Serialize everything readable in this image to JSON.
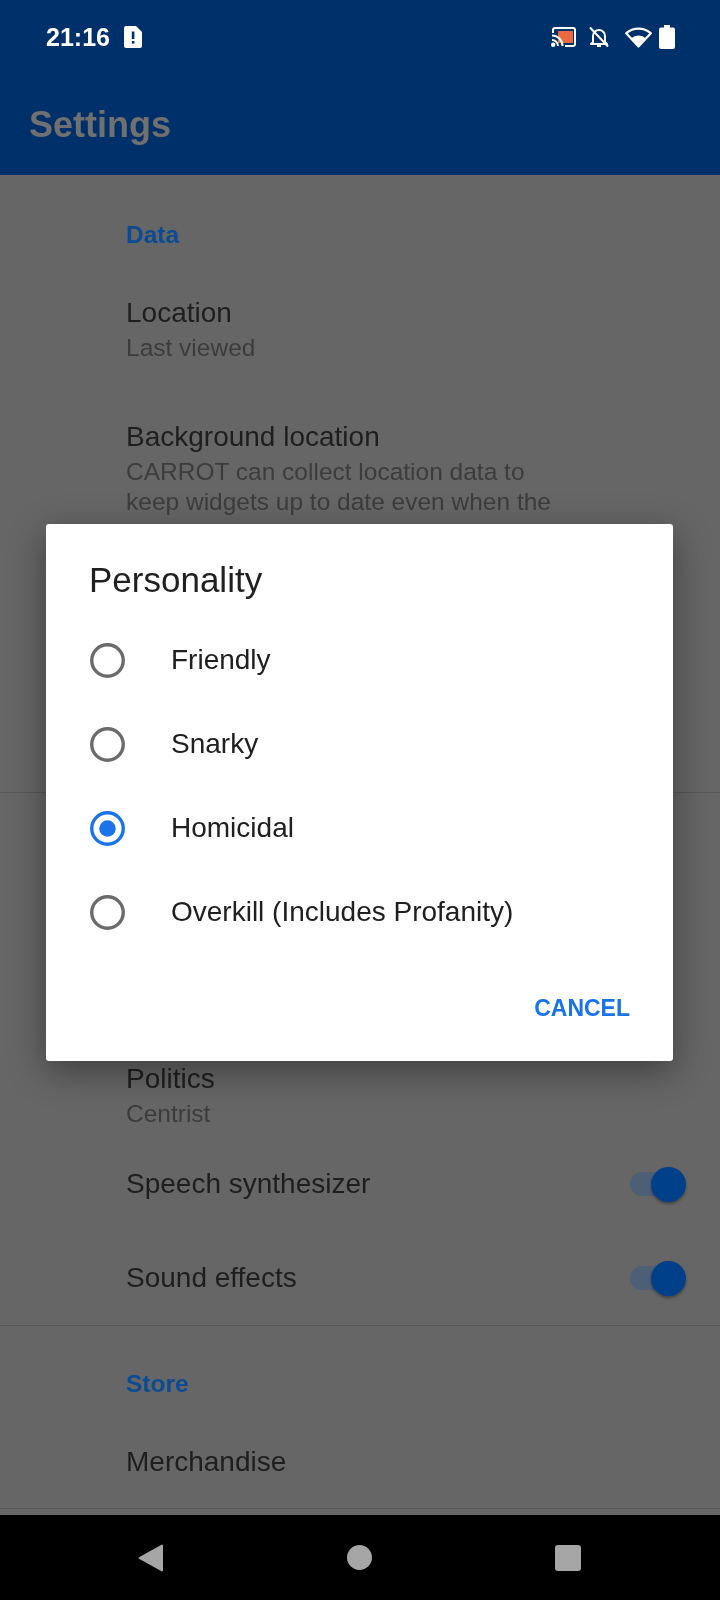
{
  "status_bar": {
    "time": "21:16"
  },
  "app_bar": {
    "title": "Settings"
  },
  "sections": [
    {
      "header": "Data",
      "items": [
        {
          "kind": "text",
          "title": "Location",
          "summary": "Last viewed"
        },
        {
          "kind": "text",
          "title": "Background location",
          "summary": "CARROT can collect location data to keep widgets up to date even when the"
        }
      ]
    },
    {
      "items": [
        {
          "kind": "text",
          "title": "Politics",
          "summary": "Centrist"
        },
        {
          "kind": "switch",
          "title": "Speech synthesizer",
          "on": true
        },
        {
          "kind": "switch",
          "title": "Sound effects",
          "on": true
        }
      ]
    },
    {
      "header": "Store",
      "items": [
        {
          "kind": "text",
          "title": "Merchandise"
        }
      ]
    }
  ],
  "dialog": {
    "title": "Personality",
    "options": [
      {
        "label": "Friendly",
        "selected": false
      },
      {
        "label": "Snarky",
        "selected": false
      },
      {
        "label": "Homicidal",
        "selected": true
      },
      {
        "label": "Overkill (Includes Profanity)",
        "selected": false
      }
    ],
    "buttons": [
      "CANCEL"
    ]
  }
}
